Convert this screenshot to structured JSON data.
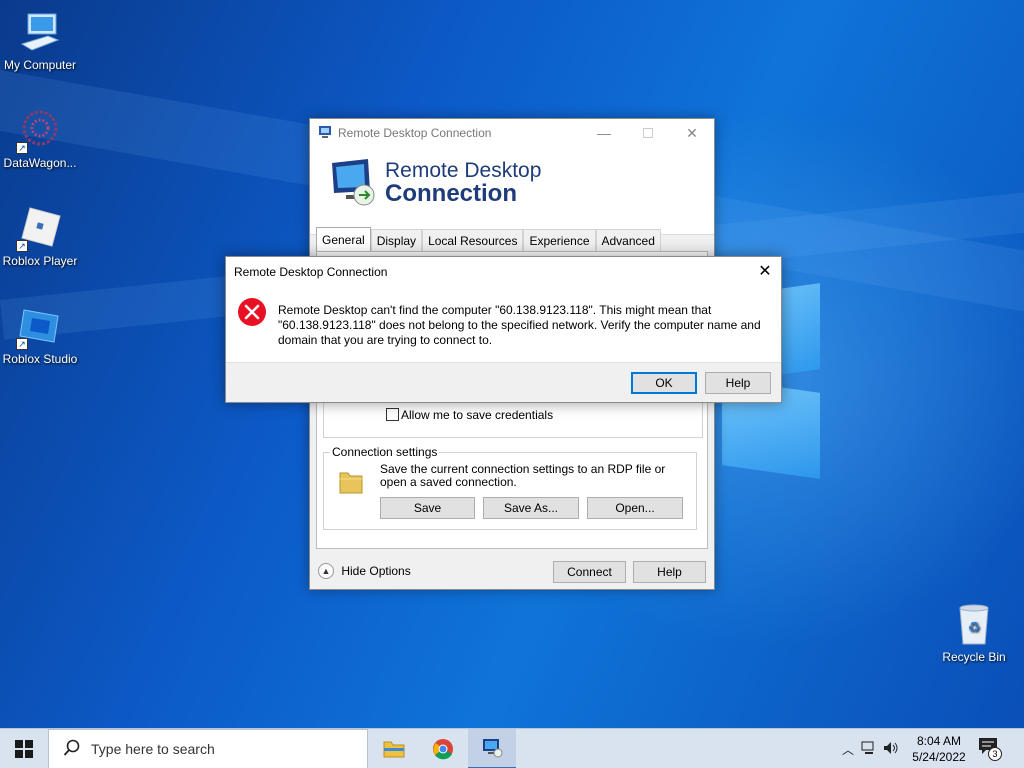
{
  "desktop": {
    "icons": [
      {
        "label": "My Computer"
      },
      {
        "label": "DataWagon..."
      },
      {
        "label": "Roblox Player"
      },
      {
        "label": "Roblox Studio"
      },
      {
        "label": "Recycle Bin"
      }
    ]
  },
  "rdp_window": {
    "title": "Remote Desktop Connection",
    "banner_line1": "Remote Desktop",
    "banner_line2": "Connection",
    "tabs": [
      "General",
      "Display",
      "Local Resources",
      "Experience",
      "Advanced"
    ],
    "selected_tab": "General",
    "allow_save_credentials_label": "Allow me to save credentials",
    "allow_save_credentials_checked": false,
    "connection_settings_legend": "Connection settings",
    "connection_settings_desc": "Save the current connection settings to an RDP file or open a saved connection.",
    "save_label": "Save",
    "save_as_label": "Save As...",
    "open_label": "Open...",
    "hide_options_label": "Hide Options",
    "connect_label": "Connect",
    "help_label": "Help"
  },
  "error_dialog": {
    "title": "Remote Desktop Connection",
    "message": "Remote Desktop can't find the computer \"60.138.9123.118\". This might mean that \"60.138.9123.118\" does not belong to the specified network.  Verify the computer name and domain that you are trying to connect to.",
    "ok_label": "OK",
    "help_label": "Help"
  },
  "taskbar": {
    "search_placeholder": "Type here to search",
    "time": "8:04 AM",
    "date": "5/24/2022",
    "notification_count": "3"
  },
  "colors": {
    "accent": "#0078d7",
    "error_red": "#e81123",
    "banner_text": "#1f3c7a"
  }
}
